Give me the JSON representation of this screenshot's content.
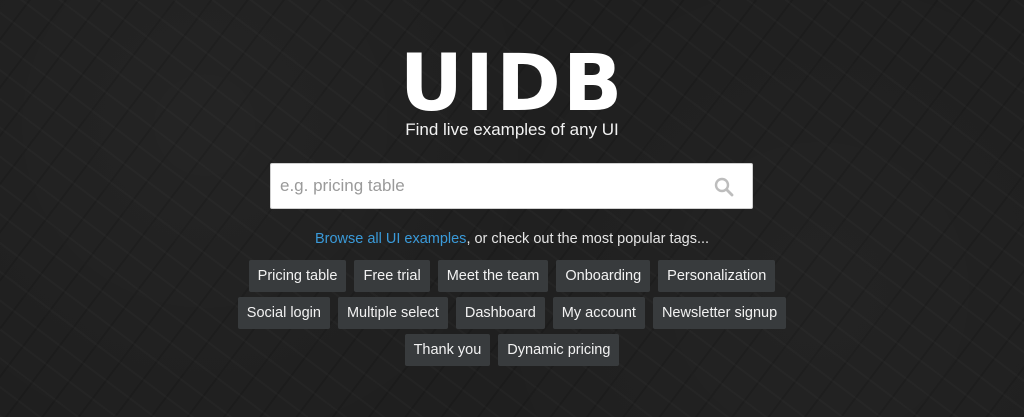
{
  "logo": "UIDB",
  "tagline": "Find live examples of any UI",
  "search": {
    "placeholder": "e.g. pricing table",
    "value": "",
    "icon": "search-icon"
  },
  "browse": {
    "link_text": "Browse all UI examples",
    "rest_text": ", or check out the most popular tags..."
  },
  "tags": [
    "Pricing table",
    "Free trial",
    "Meet the team",
    "Onboarding",
    "Personalization",
    "Social login",
    "Multiple select",
    "Dashboard",
    "My account",
    "Newsletter signup",
    "Thank you",
    "Dynamic pricing"
  ],
  "colors": {
    "background": "#1f1f1f",
    "link": "#3a9ad9",
    "tag_background": "#383b3d",
    "text": "#ffffff"
  }
}
